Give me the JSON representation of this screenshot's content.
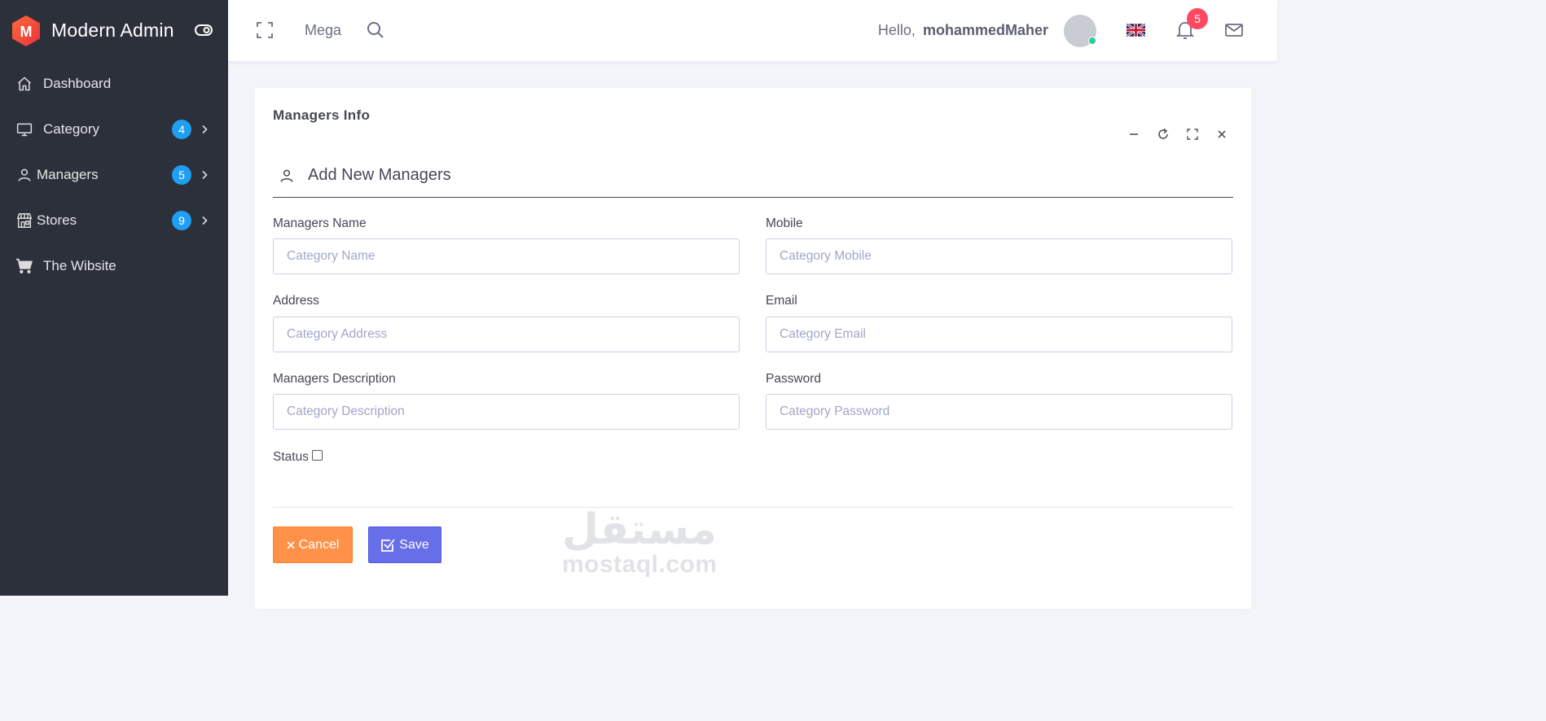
{
  "brand": {
    "name": "Modern Admin",
    "logo_letter": "M"
  },
  "sidebar": {
    "items": [
      {
        "label": "Dashboard",
        "icon": "home-icon",
        "badge": null
      },
      {
        "label": "Category",
        "icon": "monitor-icon",
        "badge": "4"
      },
      {
        "label": "Managers",
        "icon": "user-icon",
        "badge": "5"
      },
      {
        "label": "Stores",
        "icon": "store-icon",
        "badge": "9"
      },
      {
        "label": "The Wibsite",
        "icon": "cart-icon",
        "badge": null
      }
    ]
  },
  "topbar": {
    "mega_label": "Mega",
    "greeting": "Hello,",
    "username": "mohammedMaher",
    "notification_count": "5",
    "language_flag": "uk-flag-icon"
  },
  "card": {
    "title": "Managers Info",
    "section_title": "Add New Managers",
    "fields": {
      "name": {
        "label": "Managers Name",
        "placeholder": "Category Name",
        "value": ""
      },
      "mobile": {
        "label": "Mobile",
        "placeholder": "Category Mobile",
        "value": ""
      },
      "address": {
        "label": "Address",
        "placeholder": "Category Address",
        "value": ""
      },
      "email": {
        "label": "Email",
        "placeholder": "Category Email",
        "value": ""
      },
      "description": {
        "label": "Managers Description",
        "placeholder": "Category Description",
        "value": ""
      },
      "password": {
        "label": "Password",
        "placeholder": "Category Password",
        "value": ""
      }
    },
    "status_label": "Status",
    "status_checked": false,
    "cancel_label": "Cancel",
    "save_label": "Save"
  },
  "watermark": {
    "arabic": "مستقل",
    "latin": "mostaql.com"
  },
  "colors": {
    "sidebar_bg": "#2c303b",
    "badge_blue": "#1e9ff2",
    "notification_red": "#ff4961",
    "cancel_orange": "#ff9149",
    "save_indigo": "#666ee8",
    "logo_red": "#ef4a2f"
  }
}
